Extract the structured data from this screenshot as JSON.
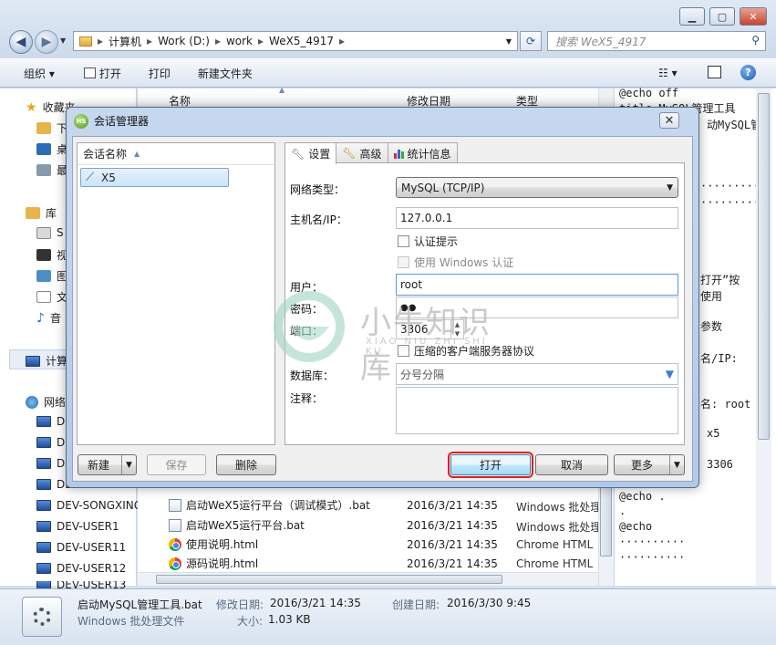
{
  "explorer": {
    "breadcrumb": [
      "计算机",
      "Work (D:)",
      "work",
      "WeX5_4917"
    ],
    "search_placeholder": "搜索 WeX5_4917",
    "toolbar": {
      "organize": "组织 ▾",
      "open": "打开",
      "print": "打印",
      "new_folder": "新建文件夹"
    },
    "nav": {
      "favorites": "收藏夹",
      "fav_items": [
        "下",
        "桌",
        "最"
      ],
      "libraries": "库",
      "lib_items": [
        "S",
        "视",
        "图",
        "文",
        "音"
      ],
      "computer": "计算",
      "network": "网络",
      "hosts": [
        "DE",
        "DE",
        "DE",
        "DE",
        "DEV-SONGXING",
        "DEV-USER1",
        "DEV-USER11",
        "DEV-USER12",
        "DEV-USER13"
      ]
    },
    "columns": {
      "name": "名称",
      "date": "修改日期",
      "type": "类型"
    },
    "files": [
      {
        "name": "启动WeX5运行平台（调试模式）.bat",
        "date": "2016/3/21 14:35",
        "type": "Windows 批处理"
      },
      {
        "name": "启动WeX5运行平台.bat",
        "date": "2016/3/21 14:35",
        "type": "Windows 批处理"
      },
      {
        "name": "使用说明.html",
        "date": "2016/3/21 14:35",
        "type": "Chrome HTML"
      },
      {
        "name": "源码说明.html",
        "date": "2016/3/21 14:35",
        "type": "Chrome HTML"
      }
    ],
    "preview_lines": [
      "@echo off",
      "title MySQL管理工具",
      "动MySQL管",
      "",
      "",
      "·········",
      "·········",
      "",
      "",
      "打开”按",
      "使用",
      "",
      "参数",
      "",
      "名/IP:",
      "",
      "",
      "名: root",
      "",
      "x5",
      "",
      "3306",
      "",
      "@echo .",
      ".",
      "@echo",
      "··········",
      "··········"
    ],
    "details": {
      "filename": "启动MySQL管理工具.bat",
      "modified_label": "修改日期:",
      "modified": "2016/3/21 14:35",
      "created_label": "创建日期:",
      "created": "2016/3/30 9:45",
      "type": "Windows 批处理文件",
      "size_label": "大小:",
      "size": "1.03 KB"
    }
  },
  "dialog": {
    "title": "会话管理器",
    "session_header": "会话名称",
    "sessions": [
      "X5"
    ],
    "tabs": [
      "设置",
      "高级",
      "统计信息"
    ],
    "form": {
      "net_type_label": "网络类型：",
      "net_type": "MySQL (TCP/IP)",
      "host_label": "主机名/IP：",
      "host": "127.0.0.1",
      "auth_prompt": "认证提示",
      "windows_auth": "使用 Windows 认证",
      "user_label": "用户：",
      "user": "root",
      "password_label": "密码：",
      "password": "●●",
      "port_label": "端口：",
      "port": "3306",
      "compress": "压缩的客户端服务器协议",
      "db_label": "数据库：",
      "db": "分号分隔",
      "comment_label": "注释："
    },
    "buttons": {
      "new": "新建",
      "save": "保存",
      "delete": "删除",
      "open": "打开",
      "cancel": "取消",
      "more": "更多"
    },
    "highlight_color": "#e0211f"
  },
  "watermark": {
    "cn": "小牛知识库",
    "en": "XIAO NIU ZHI SHI KU"
  }
}
